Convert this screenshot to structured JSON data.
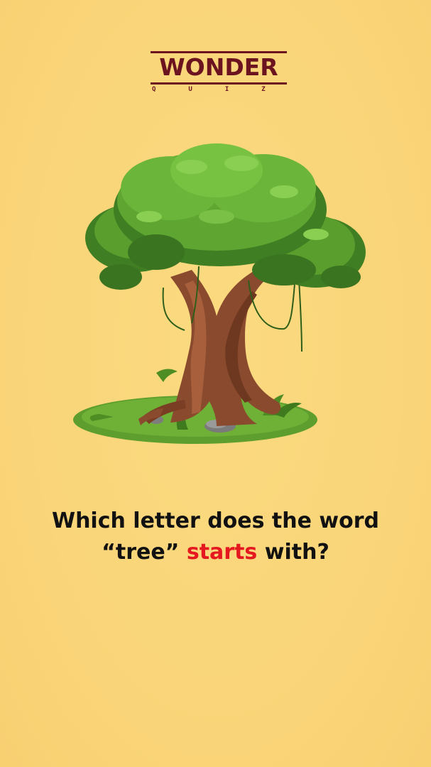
{
  "logo": {
    "word": "WONDER",
    "sub": "QUIZ"
  },
  "question": {
    "line1": "Which letter does the word",
    "line2_pre": "“tree” ",
    "line2_highlight": "starts",
    "line2_post": " with?"
  },
  "illustration": {
    "icon": "tree-illustration"
  },
  "colors": {
    "background": "#FBD77A",
    "brand": "#6B1420",
    "highlight": "#E5171F",
    "text": "#111111"
  }
}
